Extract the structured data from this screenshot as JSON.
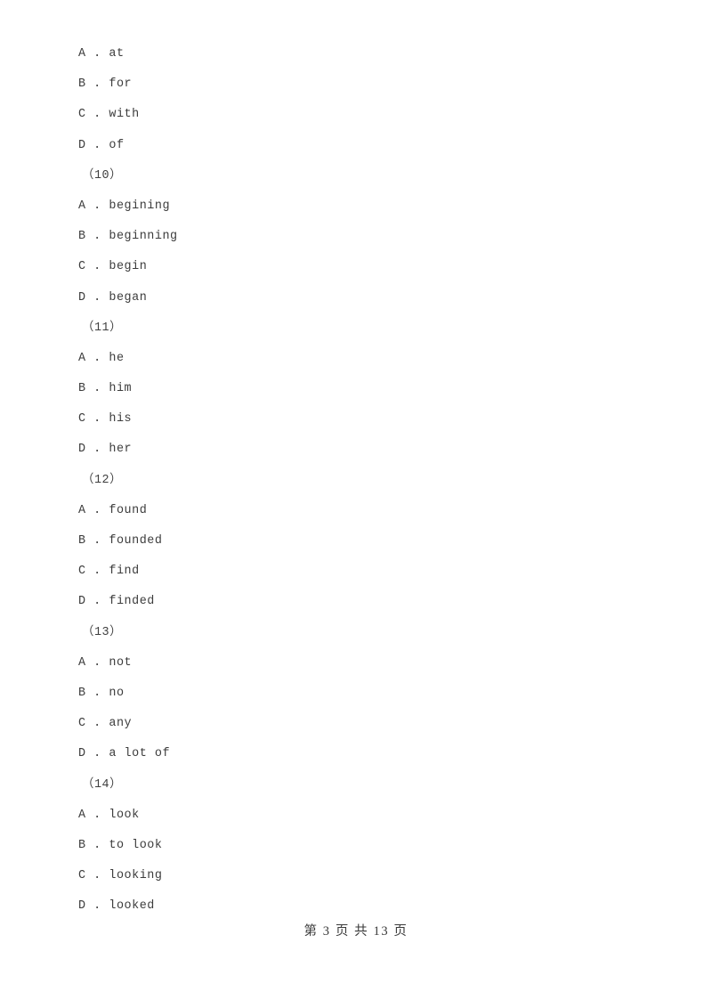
{
  "document": {
    "type": "exam-paper-page",
    "background_color": "#ffffff",
    "text_color": "#3c3c3c"
  },
  "blocks": [
    {
      "kind": "options",
      "separator": " . ",
      "items": [
        {
          "letter": "A",
          "text": "at"
        },
        {
          "letter": "B",
          "text": "for"
        },
        {
          "letter": "C",
          "text": "with"
        },
        {
          "letter": "D",
          "text": "of"
        }
      ]
    },
    {
      "kind": "question-number",
      "label": "（10）"
    },
    {
      "kind": "options",
      "separator": " . ",
      "items": [
        {
          "letter": "A",
          "text": "begining"
        },
        {
          "letter": "B",
          "text": "beginning"
        },
        {
          "letter": "C",
          "text": "begin"
        },
        {
          "letter": "D",
          "text": "began"
        }
      ]
    },
    {
      "kind": "question-number",
      "label": "（11）"
    },
    {
      "kind": "options",
      "separator": " . ",
      "items": [
        {
          "letter": "A",
          "text": "he"
        },
        {
          "letter": "B",
          "text": "him"
        },
        {
          "letter": "C",
          "text": "his"
        },
        {
          "letter": "D",
          "text": "her"
        }
      ]
    },
    {
      "kind": "question-number",
      "label": "（12）"
    },
    {
      "kind": "options",
      "separator": " . ",
      "items": [
        {
          "letter": "A",
          "text": "found"
        },
        {
          "letter": "B",
          "text": "founded"
        },
        {
          "letter": "C",
          "text": "find"
        },
        {
          "letter": "D",
          "text": "finded"
        }
      ]
    },
    {
      "kind": "question-number",
      "label": "（13）"
    },
    {
      "kind": "options",
      "separator": " . ",
      "items": [
        {
          "letter": "A",
          "text": "not"
        },
        {
          "letter": "B",
          "text": "no"
        },
        {
          "letter": "C",
          "text": "any"
        },
        {
          "letter": "D",
          "text": "a lot of"
        }
      ]
    },
    {
      "kind": "question-number",
      "label": "（14）"
    },
    {
      "kind": "options",
      "separator": " . ",
      "items": [
        {
          "letter": "A",
          "text": "look"
        },
        {
          "letter": "B",
          "text": "to look"
        },
        {
          "letter": "C",
          "text": "looking"
        },
        {
          "letter": "D",
          "text": "looked"
        }
      ]
    }
  ],
  "lines": [
    {
      "type": "option",
      "letter": "A",
      "sep": " . ",
      "text": "at"
    },
    {
      "type": "option",
      "letter": "B",
      "sep": " . ",
      "text": "for"
    },
    {
      "type": "option",
      "letter": "C",
      "sep": " . ",
      "text": "with"
    },
    {
      "type": "option",
      "letter": "D",
      "sep": " . ",
      "text": "of"
    },
    {
      "type": "qnum",
      "full": "（10）"
    },
    {
      "type": "option",
      "letter": "A",
      "sep": " . ",
      "text": "begining"
    },
    {
      "type": "option",
      "letter": "B",
      "sep": " . ",
      "text": "beginning"
    },
    {
      "type": "option",
      "letter": "C",
      "sep": " . ",
      "text": "begin"
    },
    {
      "type": "option",
      "letter": "D",
      "sep": " . ",
      "text": "began"
    },
    {
      "type": "qnum",
      "full": "（11）"
    },
    {
      "type": "option",
      "letter": "A",
      "sep": " . ",
      "text": "he"
    },
    {
      "type": "option",
      "letter": "B",
      "sep": " . ",
      "text": "him"
    },
    {
      "type": "option",
      "letter": "C",
      "sep": " . ",
      "text": "his"
    },
    {
      "type": "option",
      "letter": "D",
      "sep": " . ",
      "text": "her"
    },
    {
      "type": "qnum",
      "full": "（12）"
    },
    {
      "type": "option",
      "letter": "A",
      "sep": " . ",
      "text": "found"
    },
    {
      "type": "option",
      "letter": "B",
      "sep": " . ",
      "text": "founded"
    },
    {
      "type": "option",
      "letter": "C",
      "sep": " . ",
      "text": "find"
    },
    {
      "type": "option",
      "letter": "D",
      "sep": " . ",
      "text": "finded"
    },
    {
      "type": "qnum",
      "full": "（13）"
    },
    {
      "type": "option",
      "letter": "A",
      "sep": " . ",
      "text": "not"
    },
    {
      "type": "option",
      "letter": "B",
      "sep": " . ",
      "text": "no"
    },
    {
      "type": "option",
      "letter": "C",
      "sep": " . ",
      "text": "any"
    },
    {
      "type": "option",
      "letter": "D",
      "sep": " . ",
      "text": "a lot of"
    },
    {
      "type": "qnum",
      "full": "（14）"
    },
    {
      "type": "option",
      "letter": "A",
      "sep": " . ",
      "text": "look"
    },
    {
      "type": "option",
      "letter": "B",
      "sep": " . ",
      "text": "to look"
    },
    {
      "type": "option",
      "letter": "C",
      "sep": " . ",
      "text": "looking"
    },
    {
      "type": "option",
      "letter": "D",
      "sep": " . ",
      "text": "looked"
    }
  ],
  "footer": {
    "page_label_prefix": "第",
    "current_page": "3",
    "page_unit": "页",
    "total_prefix": "共",
    "total_pages": "13",
    "total_unit": "页",
    "full_text": "第 3 页 共 13 页"
  }
}
